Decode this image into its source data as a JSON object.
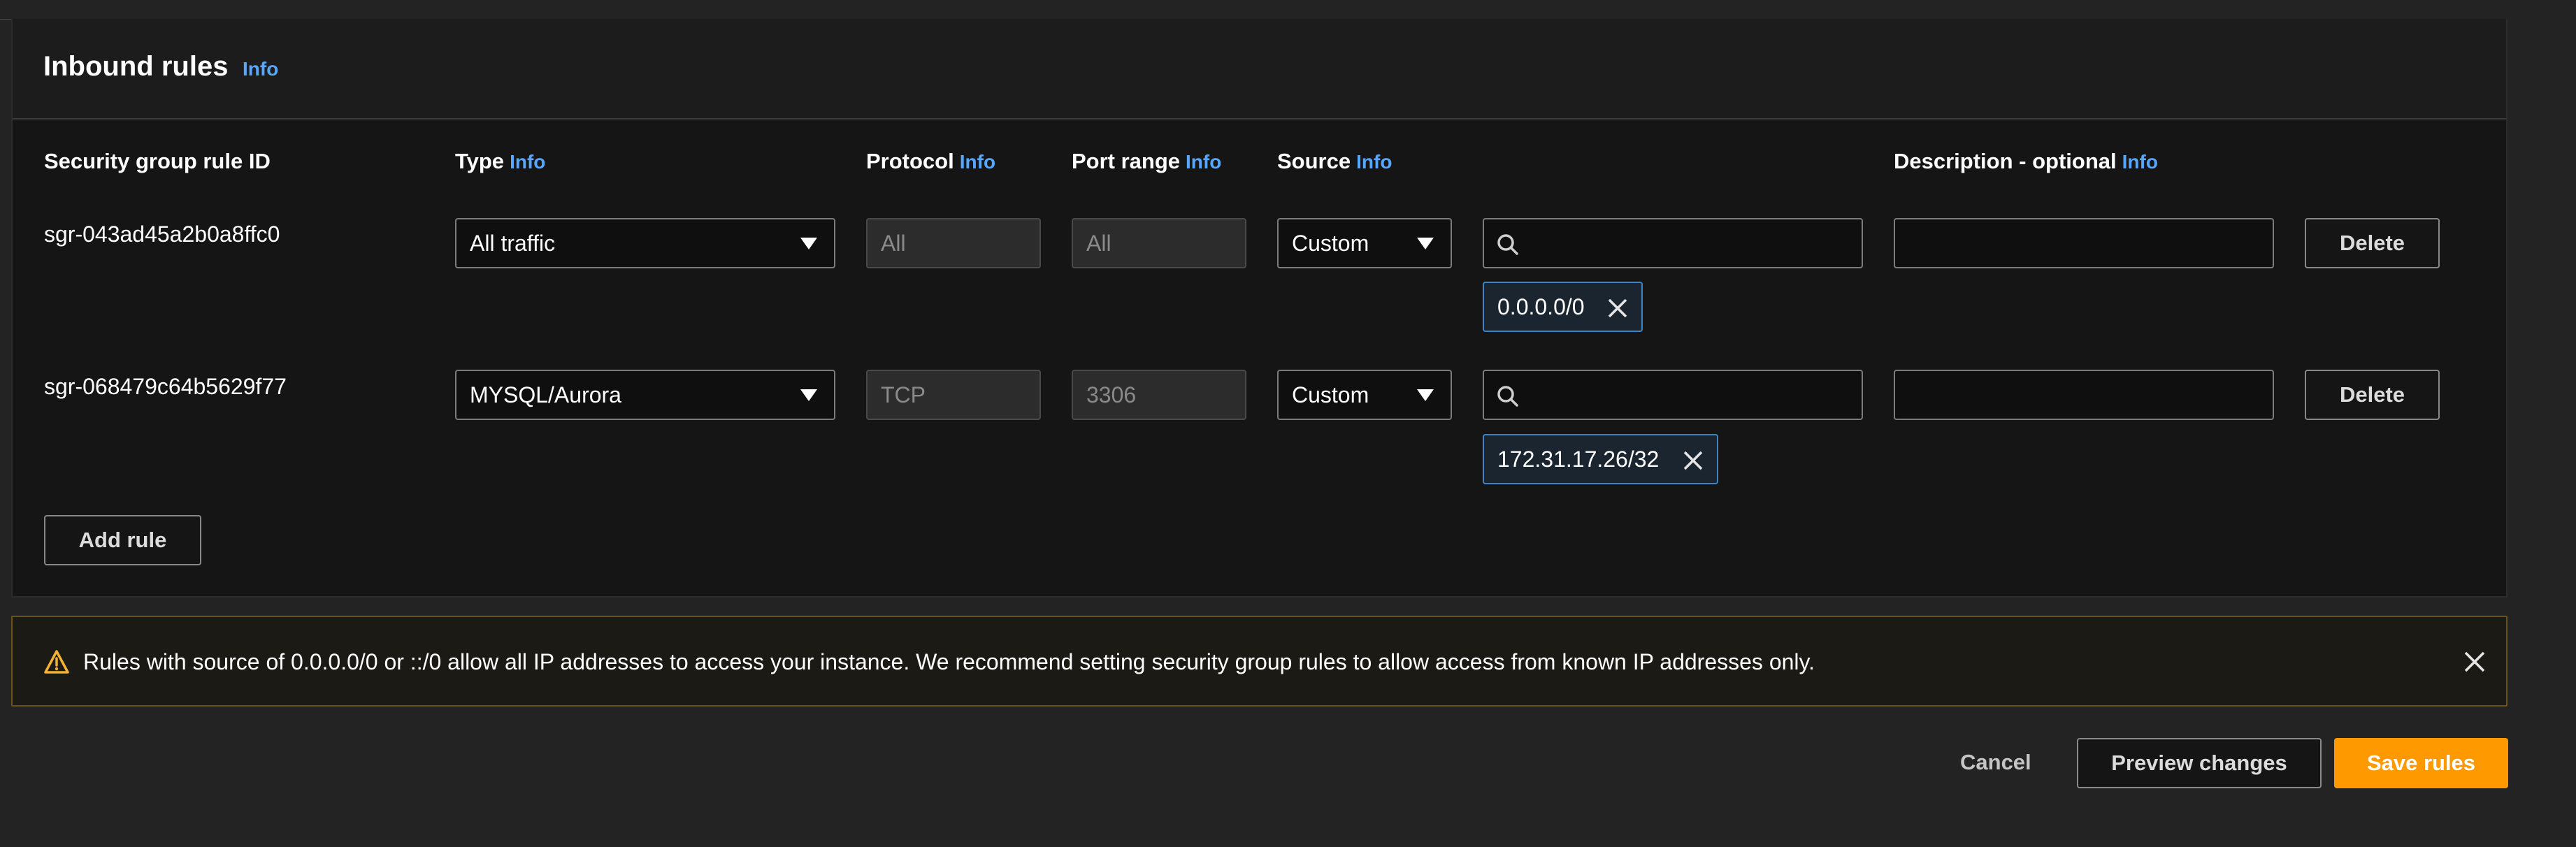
{
  "section": {
    "title": "Inbound rules",
    "info": "Info"
  },
  "columns": {
    "rule_id": "Security group rule ID",
    "type": "Type",
    "protocol": "Protocol",
    "port_range": "Port range",
    "source": "Source",
    "description": "Description - optional",
    "info": "Info"
  },
  "rules": [
    {
      "id": "sgr-043ad45a2b0a8ffc0",
      "type": "All traffic",
      "protocol": "All",
      "port_range": "All",
      "source_type": "Custom",
      "source_token": "0.0.0.0/0",
      "description": "",
      "delete_label": "Delete"
    },
    {
      "id": "sgr-068479c64b5629f77",
      "type": "MYSQL/Aurora",
      "protocol": "TCP",
      "port_range": "3306",
      "source_type": "Custom",
      "source_token": "172.31.17.26/32",
      "description": "",
      "delete_label": "Delete"
    }
  ],
  "add_rule_label": "Add rule",
  "warning": {
    "message": "Rules with source of 0.0.0.0/0 or ::/0 allow all IP addresses to access your instance. We recommend setting security group rules to allow access from known IP addresses only.",
    "icon": "warning-icon"
  },
  "footer": {
    "cancel_label": "Cancel",
    "preview_label": "Preview changes",
    "save_label": "Save rules"
  },
  "colors": {
    "accent": "#ff9900",
    "info_link": "#57a7ff",
    "warning_border": "#6a5316"
  }
}
